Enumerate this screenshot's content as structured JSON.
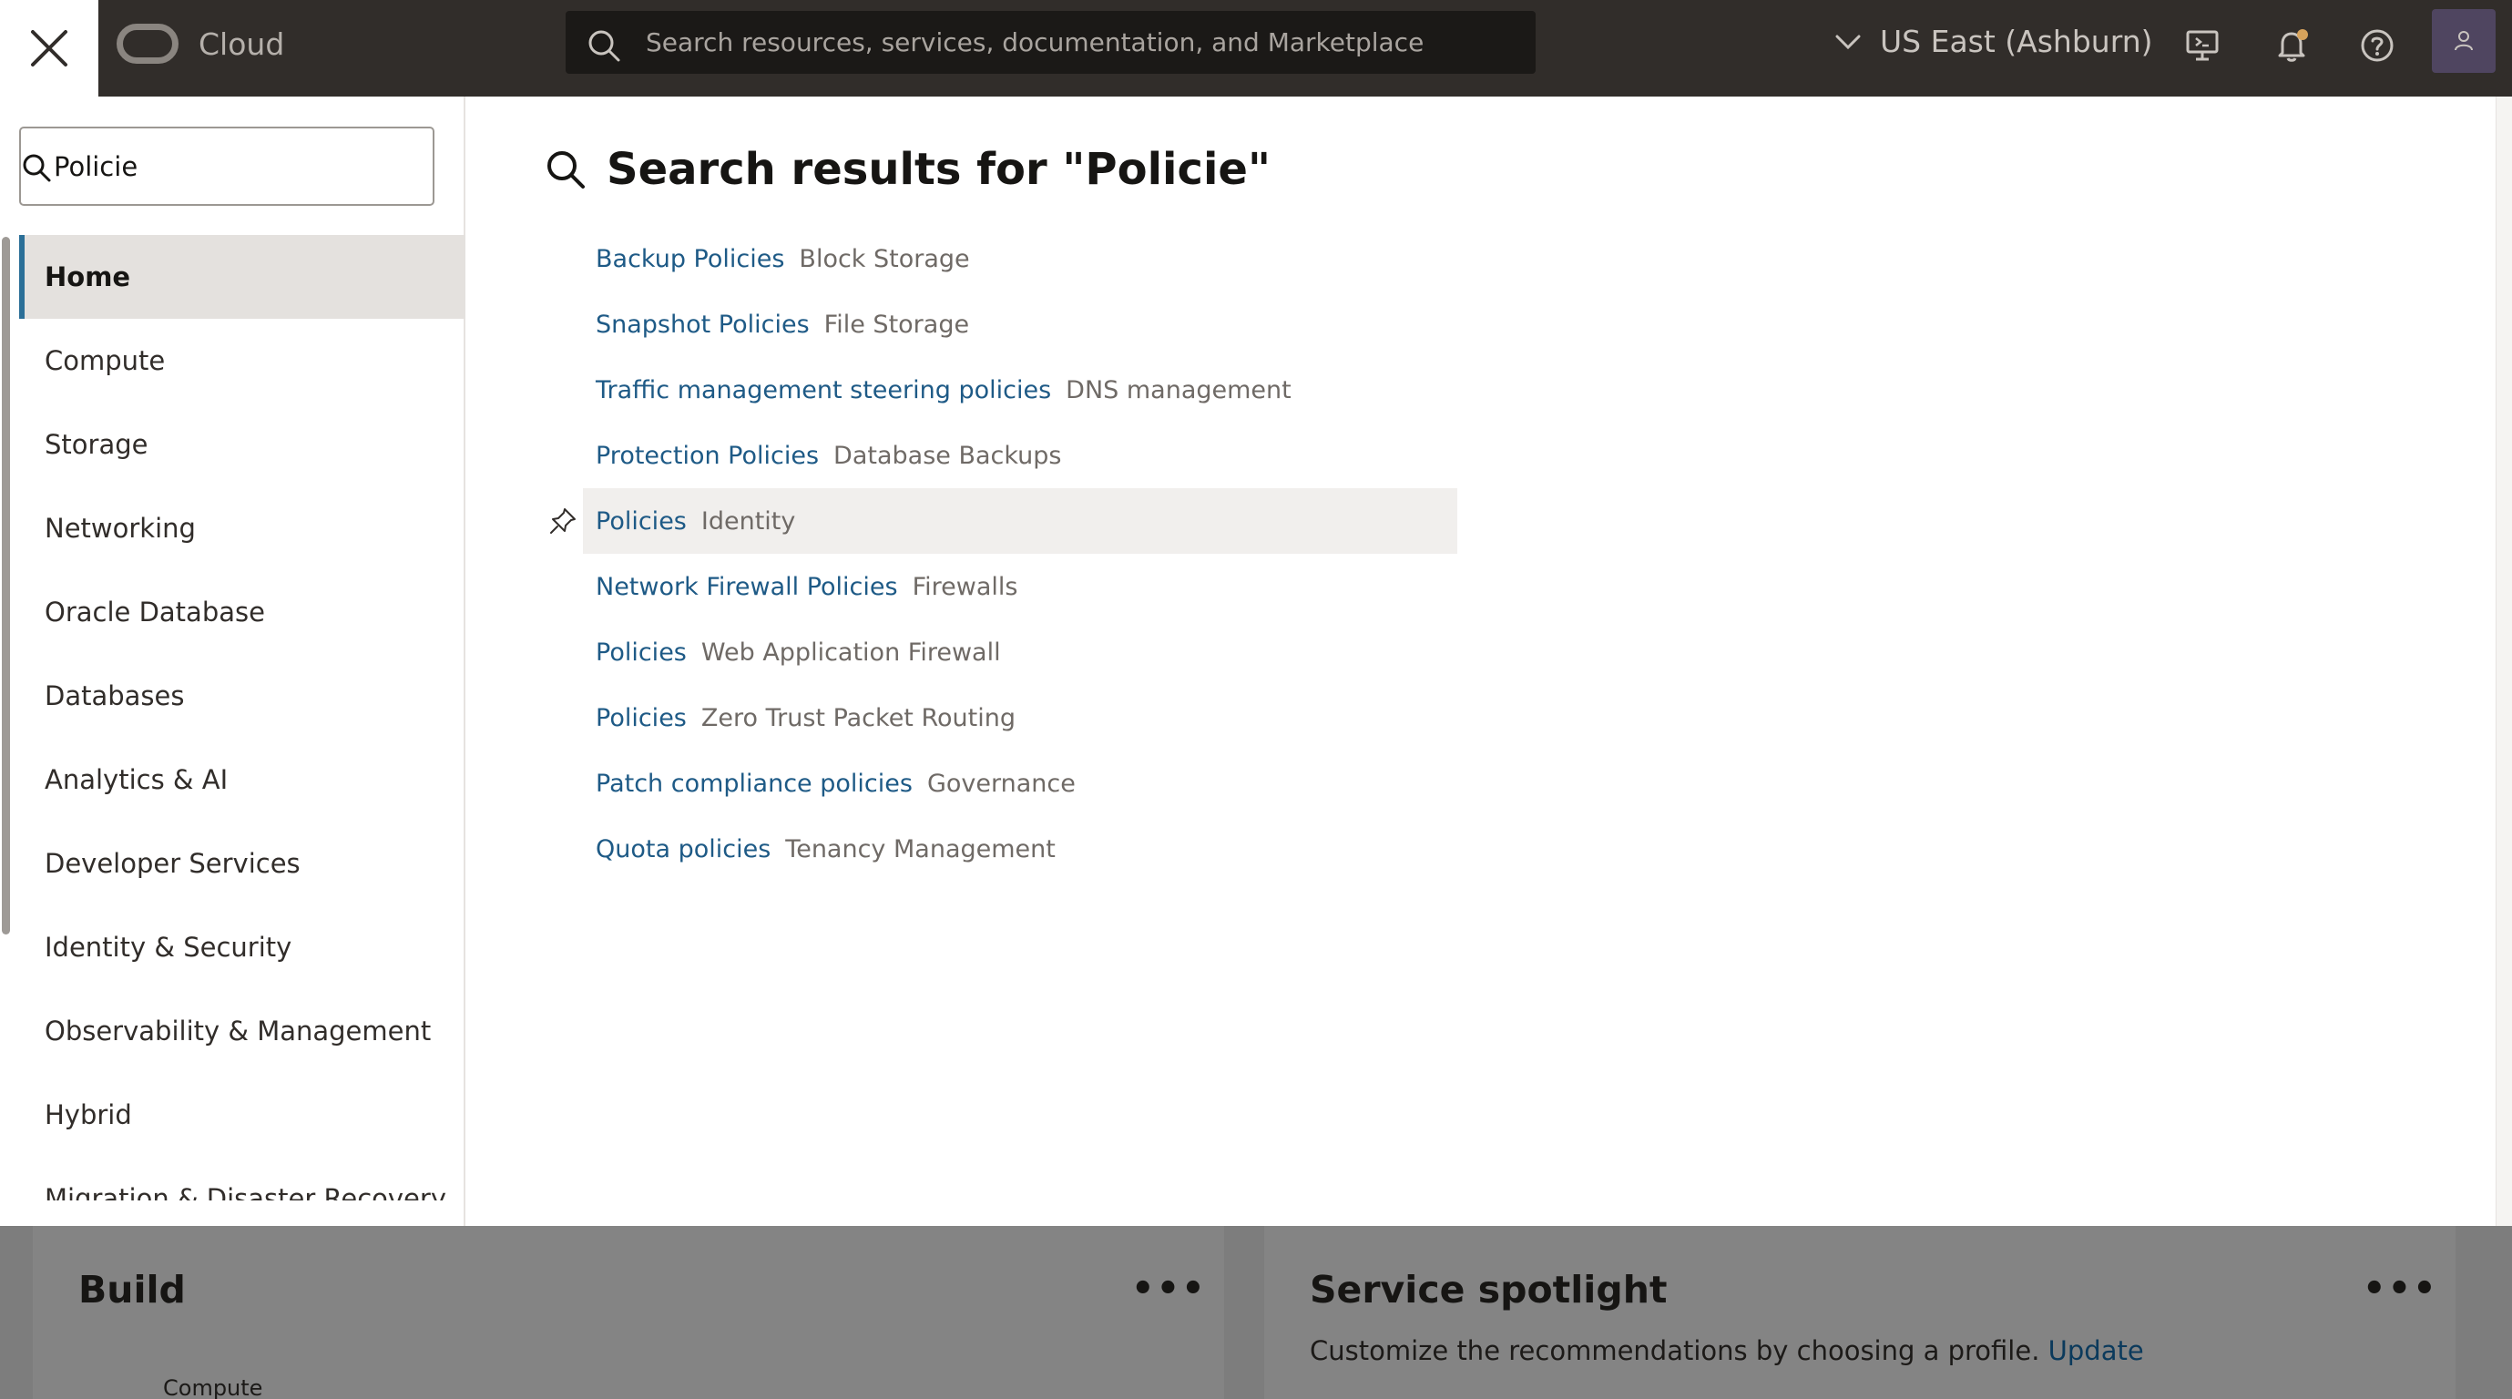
{
  "header": {
    "logo_text": "Cloud",
    "search_placeholder": "Search resources, services, documentation, and Marketplace",
    "region": "US East (Ashburn)"
  },
  "icons": [
    "close-icon",
    "search-icon",
    "chevron-down-icon",
    "cloud-shell-icon",
    "bell-icon",
    "help-icon",
    "user-icon",
    "pin-icon"
  ],
  "nav": {
    "search_value": "Policie",
    "items": [
      {
        "label": "Home"
      },
      {
        "label": "Compute"
      },
      {
        "label": "Storage"
      },
      {
        "label": "Networking"
      },
      {
        "label": "Oracle Database"
      },
      {
        "label": "Databases"
      },
      {
        "label": "Analytics & AI"
      },
      {
        "label": "Developer Services"
      },
      {
        "label": "Identity & Security"
      },
      {
        "label": "Observability & Management"
      },
      {
        "label": "Hybrid"
      },
      {
        "label": "Migration & Disaster Recovery"
      }
    ]
  },
  "results": {
    "title": "Search results for \"Policie\"",
    "items": [
      {
        "name": "Backup Policies",
        "category": "Block Storage"
      },
      {
        "name": "Snapshot Policies",
        "category": "File Storage"
      },
      {
        "name": "Traffic management steering policies",
        "category": "DNS management"
      },
      {
        "name": "Protection Policies",
        "category": "Database Backups"
      },
      {
        "name": "Policies",
        "category": "Identity"
      },
      {
        "name": "Network Firewall Policies",
        "category": "Firewalls"
      },
      {
        "name": "Policies",
        "category": "Web Application Firewall"
      },
      {
        "name": "Policies",
        "category": "Zero Trust Packet Routing"
      },
      {
        "name": "Patch compliance policies",
        "category": "Governance"
      },
      {
        "name": "Quota policies",
        "category": "Tenancy Management"
      }
    ]
  },
  "dashboard": {
    "build_title": "Build",
    "build_sub": "Compute",
    "spotlight_title": "Service spotlight",
    "spotlight_text": "Customize the recommendations by choosing a profile.",
    "spotlight_link": "Update",
    "more_label": "•••"
  },
  "colors": {
    "topbar": "#312d2a",
    "link": "#1e5a86",
    "active_accent": "#2b6f97",
    "highlight_row": "#f1efed"
  }
}
